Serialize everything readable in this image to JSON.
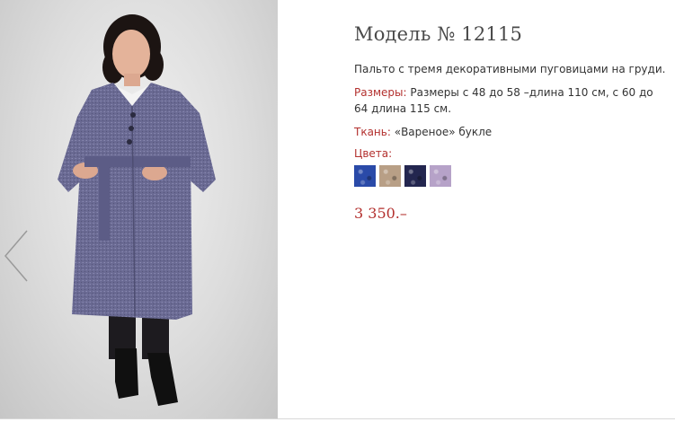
{
  "product": {
    "title": "Модель № 12115",
    "description": "Пальто с тремя декоративными пуговицами на груди.",
    "sizes_label": "Размеры:",
    "sizes_value": "Размеры с 48 до 58 –длина 110 см, с 60 до 64 длина 115 см.",
    "fabric_label": "Ткань:",
    "fabric_value": "«Вареное» букле",
    "colors_label": "Цвета:",
    "price": "3 350.–"
  },
  "swatches": [
    {
      "name": "blue",
      "color": "#2a4aa8"
    },
    {
      "name": "beige",
      "color": "#b89f86"
    },
    {
      "name": "navy",
      "color": "#23264f"
    },
    {
      "name": "lilac",
      "color": "#b6a2c8"
    }
  ],
  "colors": {
    "accent": "#b3302e",
    "coat": "#6a6a93"
  },
  "icons": {
    "prev": "chevron-left-icon"
  }
}
